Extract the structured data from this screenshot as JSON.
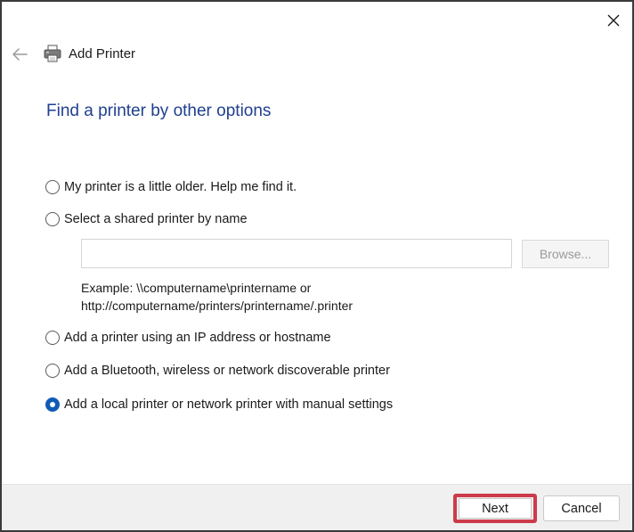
{
  "window": {
    "title": "Add Printer",
    "icons": {
      "close": "close-icon",
      "back": "back-arrow-icon",
      "app": "printer-icon"
    }
  },
  "heading": "Find a printer by other options",
  "options": [
    {
      "label": "My printer is a little older. Help me find it.",
      "checked": false
    },
    {
      "label": "Select a shared printer by name",
      "checked": false
    },
    {
      "label": "Add a printer using an IP address or hostname",
      "checked": false
    },
    {
      "label": "Add a Bluetooth, wireless or network discoverable printer",
      "checked": false
    },
    {
      "label": "Add a local printer or network printer with manual settings",
      "checked": true
    }
  ],
  "shared_printer": {
    "input_value": "",
    "browse_label": "Browse...",
    "example_line1": "Example: \\\\computername\\printername or",
    "example_line2": "http://computername/printers/printername/.printer"
  },
  "footer": {
    "next_label": "Next",
    "cancel_label": "Cancel"
  },
  "colors": {
    "heading": "#1f3f8f",
    "accent": "#0f5bb5",
    "highlight": "#cd3b4a"
  }
}
